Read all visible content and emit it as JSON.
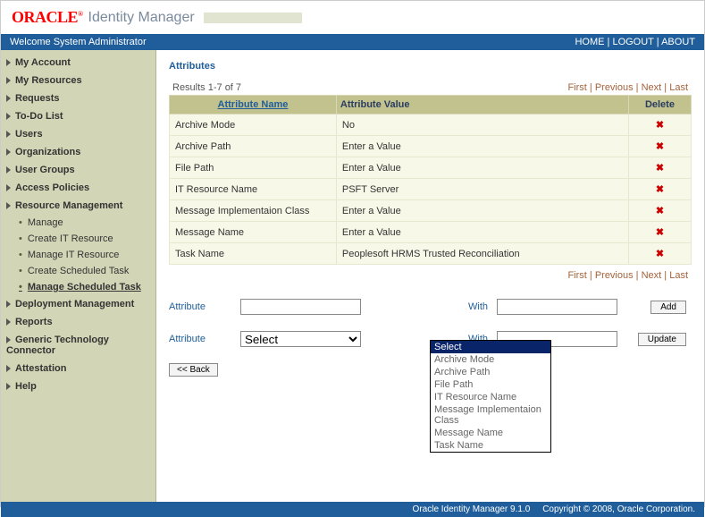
{
  "header": {
    "logo_red": "ORACLE",
    "logo_text": "Identity Manager"
  },
  "welcome": {
    "text": "Welcome System Administrator",
    "home": "HOME",
    "logout": "LOGOUT",
    "about": "ABOUT"
  },
  "sidebar": {
    "items": [
      {
        "label": "My Account"
      },
      {
        "label": "My Resources"
      },
      {
        "label": "Requests"
      },
      {
        "label": "To-Do List"
      },
      {
        "label": "Users"
      },
      {
        "label": "Organizations"
      },
      {
        "label": "User Groups"
      },
      {
        "label": "Access Policies"
      },
      {
        "label": "Resource Management",
        "sub": [
          "Manage",
          "Create IT Resource",
          "Manage IT Resource",
          "Create Scheduled Task",
          "Manage Scheduled Task"
        ],
        "active_index": 4
      },
      {
        "label": "Deployment Management"
      },
      {
        "label": "Reports"
      },
      {
        "label": "Generic Technology Connector"
      },
      {
        "label": "Attestation"
      },
      {
        "label": "Help"
      }
    ]
  },
  "main": {
    "title": "Attributes",
    "results_text": "Results 1-7 of 7",
    "pager": {
      "first": "First",
      "previous": "Previous",
      "next": "Next",
      "last": "Last"
    },
    "columns": {
      "name": "Attribute Name",
      "value": "Attribute Value",
      "delete": "Delete"
    },
    "rows": [
      {
        "name": "Archive Mode",
        "value": "No"
      },
      {
        "name": "Archive Path",
        "value": "Enter a Value"
      },
      {
        "name": "File Path",
        "value": "Enter a Value"
      },
      {
        "name": "IT Resource Name",
        "value": "PSFT Server"
      },
      {
        "name": "Message Implementaion Class",
        "value": "Enter a Value"
      },
      {
        "name": "Message Name",
        "value": "Enter a Value"
      },
      {
        "name": "Task Name",
        "value": "Peoplesoft HRMS Trusted Reconciliation"
      }
    ],
    "form": {
      "attribute_label": "Attribute",
      "with_label": "With",
      "add_btn": "Add",
      "update_btn": "Update",
      "select_default": "Select",
      "back_btn": "<< Back"
    },
    "dropdown_options": [
      "Select",
      "Archive Mode",
      "Archive Path",
      "File Path",
      "IT Resource Name",
      "Message Implementaion Class",
      "Message Name",
      "Task Name"
    ]
  },
  "footer": {
    "product": "Oracle Identity Manager 9.1.0",
    "copyright": "Copyright © 2008, Oracle Corporation."
  }
}
